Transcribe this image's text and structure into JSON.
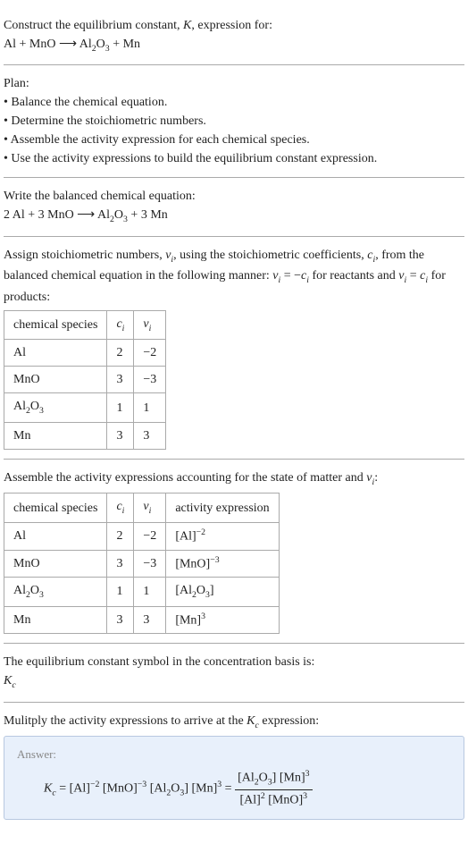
{
  "intro": {
    "line1": "Construct the equilibrium constant, ",
    "K": "K",
    "line1b": ", expression for:",
    "eq": "Al + MnO ⟶ Al",
    "sub1": "2",
    "eq2": "O",
    "sub2": "3",
    "eq3": " + Mn"
  },
  "plan": {
    "title": "Plan:",
    "b1": "• Balance the chemical equation.",
    "b2": "• Determine the stoichiometric numbers.",
    "b3": "• Assemble the activity expression for each chemical species.",
    "b4": "• Use the activity expressions to build the equilibrium constant expression."
  },
  "balanced": {
    "title": "Write the balanced chemical equation:",
    "eq1": "2 Al + 3 MnO ⟶ Al",
    "sub1": "2",
    "eq2": "O",
    "sub2": "3",
    "eq3": " + 3 Mn"
  },
  "stoich": {
    "text1": "Assign stoichiometric numbers, ",
    "nu": "ν",
    "i": "i",
    "text2": ", using the stoichiometric coefficients, ",
    "c": "c",
    "text3": ", from the balanced chemical equation in the following manner: ",
    "eq1a": "ν",
    "eq1b": " = −",
    "eq1c": "c",
    "text4": " for reactants and ",
    "eq2a": "ν",
    "eq2b": " = ",
    "eq2c": "c",
    "text5": " for products:",
    "table": {
      "h1": "chemical species",
      "h2": "c",
      "h2i": "i",
      "h3": "ν",
      "h3i": "i",
      "r1": {
        "sp": "Al",
        "c": "2",
        "v": "−2"
      },
      "r2": {
        "sp": "MnO",
        "c": "3",
        "v": "−3"
      },
      "r3": {
        "sp_a": "Al",
        "sp_s1": "2",
        "sp_b": "O",
        "sp_s2": "3",
        "c": "1",
        "v": "1"
      },
      "r4": {
        "sp": "Mn",
        "c": "3",
        "v": "3"
      }
    }
  },
  "activity": {
    "text1": "Assemble the activity expressions accounting for the state of matter and ",
    "nu": "ν",
    "i": "i",
    "text2": ":",
    "table": {
      "h1": "chemical species",
      "h2": "c",
      "h2i": "i",
      "h3": "ν",
      "h3i": "i",
      "h4": "activity expression",
      "r1": {
        "sp": "Al",
        "c": "2",
        "v": "−2",
        "a": "[Al]",
        "e": "−2"
      },
      "r2": {
        "sp": "MnO",
        "c": "3",
        "v": "−3",
        "a": "[MnO]",
        "e": "−3"
      },
      "r3": {
        "sp_a": "Al",
        "sp_s1": "2",
        "sp_b": "O",
        "sp_s2": "3",
        "c": "1",
        "v": "1",
        "a1": "[Al",
        "as1": "2",
        "a2": "O",
        "as2": "3",
        "a3": "]"
      },
      "r4": {
        "sp": "Mn",
        "c": "3",
        "v": "3",
        "a": "[Mn]",
        "e": "3"
      }
    }
  },
  "symbol": {
    "text": "The equilibrium constant symbol in the concentration basis is:",
    "K": "K",
    "c": "c"
  },
  "final": {
    "text1": "Mulitply the activity expressions to arrive at the ",
    "K": "K",
    "c": "c",
    "text2": " expression:",
    "answerLabel": "Answer:",
    "lhs_K": "K",
    "lhs_c": "c",
    "eq": " = [Al]",
    "e1": "−2",
    "t2": " [MnO]",
    "e2": "−3",
    "t3": " [Al",
    "s1": "2",
    "t4": "O",
    "s2": "3",
    "t5": "] [Mn]",
    "e3": "3",
    "eq2": " = ",
    "num1": "[Al",
    "ns1": "2",
    "num2": "O",
    "ns2": "3",
    "num3": "] [Mn]",
    "ne": "3",
    "den1": "[Al]",
    "de1": "2",
    "den2": " [MnO]",
    "de2": "3"
  }
}
